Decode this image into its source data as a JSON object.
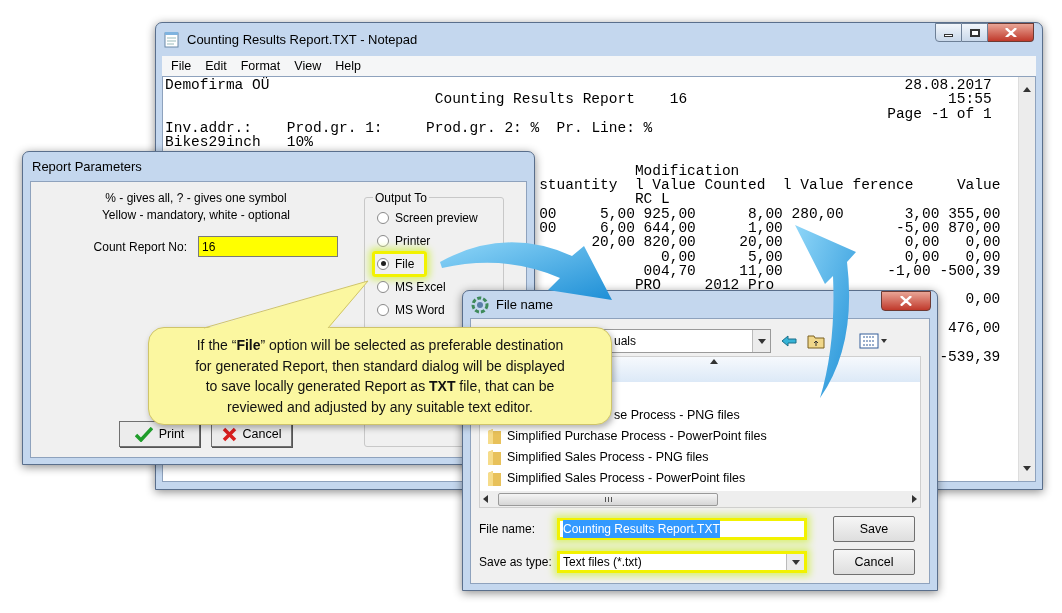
{
  "notepad": {
    "title": "Counting Results Report.TXT - Notepad",
    "menu": [
      "File",
      "Edit",
      "Format",
      "View",
      "Help"
    ],
    "company": "Demofirma OÜ",
    "date": "28.08.2017",
    "report_title": "Counting Results Report    16",
    "time": "15:55",
    "page": "Page -1 of 1",
    "filter_line": "Inv.addr.:    Prod.gr. 1:     Prod.gr. 2: %  Pr. Line: %",
    "group_line": "Bikes29inch   10%",
    "data_lines": [
      "           Modification",
      "stuantity  l Value Counted  l Value ference     Value",
      "           RC L",
      "00     5,00 925,00      8,00 280,00       3,00 355,00",
      "00     6,00 644,00      1,00             -5,00 870,00",
      "      20,00 820,00     20,00              0,00   0,00",
      "              0,00      5,00              0,00   0,00",
      "            004,70     11,00            -1,00 -500,39",
      "           PRO     2012 Pro"
    ],
    "totals": [
      "0,00",
      "476,00",
      "-539,39"
    ]
  },
  "report_dialog": {
    "title": "Report Parameters",
    "hints": [
      "% - gives all, ? - gives one symbol",
      "Yellow - mandatory, white - optional"
    ],
    "count_label": "Count Report No:",
    "count_value": "16",
    "output_group": "Output To",
    "options": [
      {
        "label": "Screen preview",
        "selected": false,
        "highlighted": false
      },
      {
        "label": "Printer",
        "selected": false,
        "highlighted": false
      },
      {
        "label": "File",
        "selected": true,
        "highlighted": true
      },
      {
        "label": "MS Excel",
        "selected": false,
        "highlighted": false
      },
      {
        "label": "MS Word",
        "selected": false,
        "highlighted": false
      }
    ],
    "buttons": [
      {
        "label": "Print",
        "kind": "print"
      },
      {
        "label": "Cancel",
        "kind": "cancel"
      }
    ]
  },
  "callout": {
    "lines": [
      "If the “**File**” option will be selected as preferable destination",
      "for generated Report, then standard dialog will be displayed",
      "to save locally generated Report as **TXT** file, that can be",
      "reviewed and adjusted by any suitable text editor."
    ]
  },
  "file_dialog": {
    "title": "File name",
    "folder": "uals",
    "items": [
      {
        "kind": "clipped",
        "label": "se Process - PNG files"
      },
      {
        "kind": "folder",
        "label": "Simplified Purchase Process - PowerPoint files"
      },
      {
        "kind": "folder",
        "label": "Simplified Sales Process - PNG files"
      },
      {
        "kind": "folder",
        "label": "Simplified Sales Process - PowerPoint files"
      }
    ],
    "file_name_label": "File name:",
    "file_name": {
      "value": "Counting Results Report.TXT",
      "highlighted": true,
      "text_selected": true
    },
    "type_label": "Save as type:",
    "type": {
      "value": "Text files (*.txt)",
      "highlighted": true
    },
    "save_button": "Save",
    "cancel_button": "Cancel"
  }
}
